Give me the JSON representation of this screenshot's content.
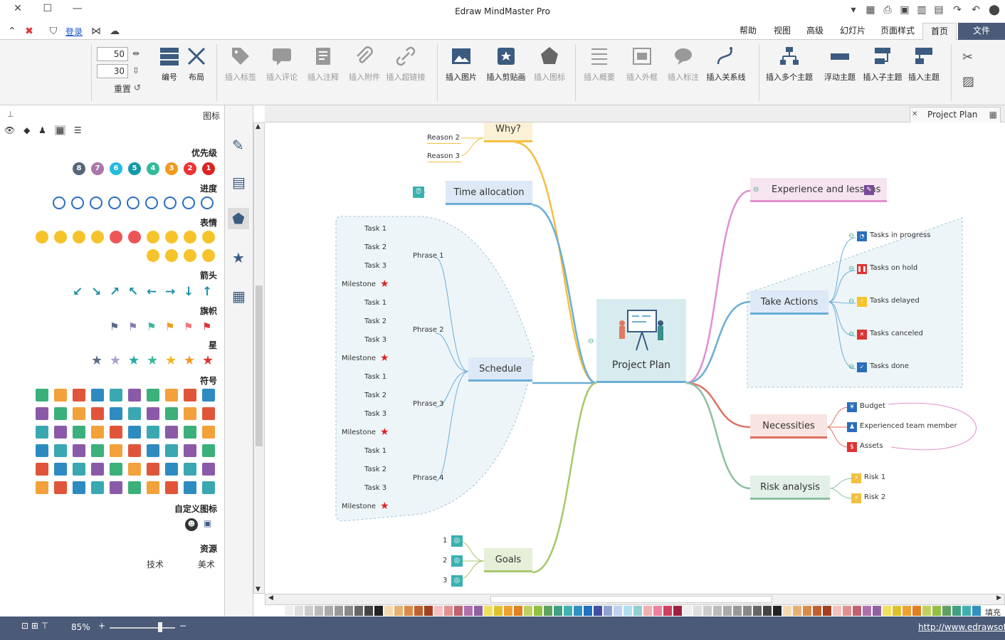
{
  "app": {
    "title": "Edraw MindMaster Pro"
  },
  "window": {
    "close_glyph": "✕",
    "maximize_glyph": "☐",
    "minimize_glyph": "—"
  },
  "tabs": [
    {
      "label": "文件",
      "active": false,
      "file": true
    },
    {
      "label": "首页",
      "active": true
    },
    {
      "label": "页面样式",
      "active": false
    },
    {
      "label": "幻灯片",
      "active": false
    },
    {
      "label": "高级",
      "active": false
    },
    {
      "label": "视图",
      "active": false
    },
    {
      "label": "帮助",
      "active": false
    }
  ],
  "login": {
    "label": "登录"
  },
  "ribbon": {
    "insert_topic": "插入主题",
    "insert_subtopic": "插入子主题",
    "floating_topic": "浮动主题",
    "multiple_topics": "插入多个主题",
    "relationship": "插入关系线",
    "callout": "插入标注",
    "boundary": "插入外框",
    "summary": "插入概要",
    "icon": "插入图标",
    "clipart": "插入剪贴画",
    "image": "插入图片",
    "hyperlink": "插入超链接",
    "attachment": "插入附件",
    "note": "插入注释",
    "comment": "插入评论",
    "tag": "插入标签",
    "layout": "布局",
    "numbering": "编号",
    "reset": "重置",
    "spacing_h": "50",
    "spacing_v": "30"
  },
  "left_panel": {
    "title": "图标",
    "sections": {
      "priority": "优先级",
      "progress": "进度",
      "expression": "表情",
      "arrow": "箭头",
      "flag": "旗帜",
      "star": "星",
      "symbol": "符号",
      "custom": "自定义图标",
      "resource": "资源"
    },
    "priority_numbers": [
      "1",
      "2",
      "3",
      "4",
      "5",
      "6",
      "7",
      "8"
    ],
    "resource_items": [
      "美术",
      "技术"
    ]
  },
  "document": {
    "tab_label": "Project Plan",
    "close_glyph": "✕"
  },
  "mindmap": {
    "center": "Project Plan",
    "right": {
      "experience": "Experience and lessons",
      "take_actions": "Take Actions",
      "take_actions_children": [
        "Tasks in progress",
        "Tasks on hold",
        "Tasks delayed",
        "Tasks canceled",
        "Tasks done"
      ],
      "necessities": "Necessities",
      "necessities_children": [
        "Budget",
        "Experienced team member",
        "Assets"
      ],
      "risk": "Risk analysis",
      "risk_children": [
        "Risk 1",
        "Risk 2"
      ]
    },
    "left": {
      "why": "Why?",
      "why_children": [
        "Reason 2",
        "Reason 3"
      ],
      "time": "Time allocation",
      "schedule": "Schedule",
      "phases": [
        "Phrase 1",
        "Phrase 2",
        "Phrase 3",
        "Phrase 4"
      ],
      "task_labels": [
        "Task 1",
        "Task 2",
        "Task 3",
        "Milestone"
      ],
      "goals": "Goals",
      "goals_children": [
        "1",
        "2",
        "3"
      ]
    }
  },
  "status": {
    "url": "http://www.edrawsoft.cn",
    "zoom": "85%",
    "zoom_plus": "+",
    "zoom_minus": "−"
  },
  "palette_label": "填充",
  "colors": {
    "file_tab": "#4a5a78",
    "status": "#4a5a78",
    "center_bg": "#d8ecef"
  }
}
